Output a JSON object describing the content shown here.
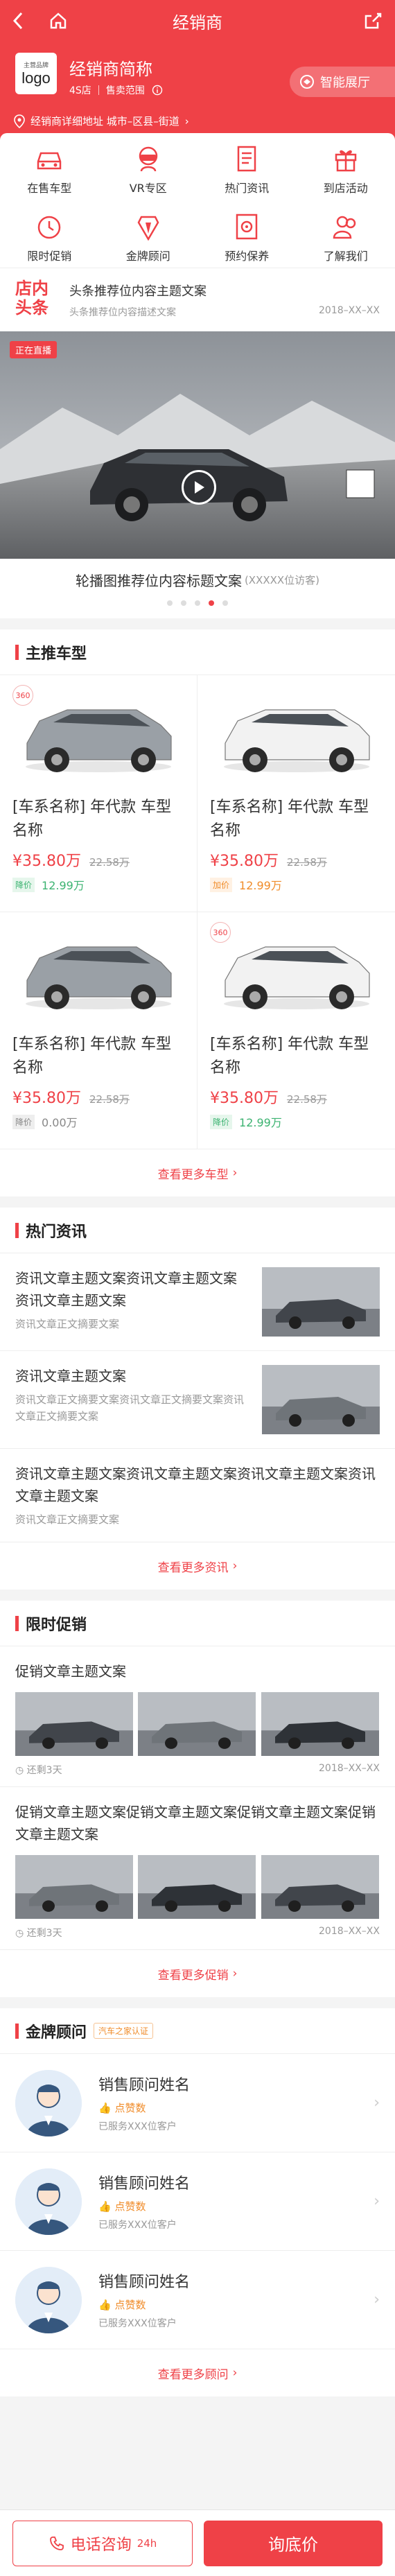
{
  "topbar": {
    "title": "经销商"
  },
  "header": {
    "logo_top": "主营品牌",
    "logo_bottom": "logo",
    "dealer_name": "经销商简称",
    "store_type": "4S店",
    "sales_scope": "售卖范围",
    "showroom_label": "智能展厅",
    "address": "经销商详细地址 城市–区县–街道"
  },
  "features": [
    {
      "label": "在售车型",
      "icon": "car-icon"
    },
    {
      "label": "VR专区",
      "icon": "vr-icon"
    },
    {
      "label": "热门资讯",
      "icon": "news-icon"
    },
    {
      "label": "到店活动",
      "icon": "gift-icon"
    },
    {
      "label": "限时促销",
      "icon": "clock-icon"
    },
    {
      "label": "金牌顾问",
      "icon": "advisor-icon"
    },
    {
      "label": "预约保养",
      "icon": "maintenance-icon"
    },
    {
      "label": "了解我们",
      "icon": "people-icon"
    }
  ],
  "headline": {
    "logo_line1": "店内",
    "logo_line2": "头条",
    "title": "头条推荐位内容主题文案",
    "desc": "头条推荐位内容描述文案",
    "date": "2018–XX–XX"
  },
  "banner": {
    "live_tag": "正在直播",
    "caption": "轮播图推荐位内容标题文案",
    "visitors": "(XXXXX位访客)",
    "active_dot": 3,
    "dot_count": 5
  },
  "main_models": {
    "title": "主推车型",
    "more": "查看更多车型",
    "cars": [
      {
        "name": "[车系名称] 年代款 车型名称",
        "price": "¥35.80万",
        "old_price": "22.58万",
        "diff_label": "降价",
        "diff_value": "12.99万",
        "badge": "360",
        "diff_type": "down"
      },
      {
        "name": "[车系名称] 年代款 车型名称",
        "price": "¥35.80万",
        "old_price": "22.58万",
        "diff_label": "加价",
        "diff_value": "12.99万",
        "badge": "",
        "diff_type": "up"
      },
      {
        "name": "[车系名称] 年代款 车型名称",
        "price": "¥35.80万",
        "old_price": "22.58万",
        "diff_label": "降价",
        "diff_value": "0.00万",
        "badge": "",
        "diff_type": "zero"
      },
      {
        "name": "[车系名称] 年代款 车型名称",
        "price": "¥35.80万",
        "old_price": "22.58万",
        "diff_label": "降价",
        "diff_value": "12.99万",
        "badge": "360",
        "diff_type": "down"
      }
    ]
  },
  "news": {
    "title": "热门资讯",
    "more": "查看更多资讯",
    "items": [
      {
        "title": "资讯文章主题文案资讯文章主题文案资讯文章主题文案",
        "summary": "资讯文章正文摘要文案",
        "has_image": true
      },
      {
        "title": "资讯文章主题文案",
        "summary": "资讯文章正文摘要文案资讯文章正文摘要文案资讯文章正文摘要文案",
        "has_image": true
      },
      {
        "title": "资讯文章主题文案资讯文章主题文案资讯文章主题文案资讯文章主题文案",
        "summary": "资讯文章正文摘要文案",
        "has_image": false
      }
    ]
  },
  "promo": {
    "title": "限时促销",
    "more": "查看更多促销",
    "items": [
      {
        "title": "促销文章主题文案",
        "remaining": "还剩3天",
        "date": "2018–XX–XX"
      },
      {
        "title": "促销文章主题文案促销文章主题文案促销文章主题文案促销文章主题文案",
        "remaining": "还剩3天",
        "date": "2018–XX–XX"
      }
    ]
  },
  "advisors": {
    "title": "金牌顾问",
    "tag": "汽车之家认证",
    "more": "查看更多顾问",
    "items": [
      {
        "name": "销售顾问姓名",
        "likes": "点赞数",
        "served": "已服务XXX位客户"
      },
      {
        "name": "销售顾问姓名",
        "likes": "点赞数",
        "served": "已服务XXX位客户"
      },
      {
        "name": "销售顾问姓名",
        "likes": "点赞数",
        "served": "已服务XXX位客户"
      }
    ]
  },
  "bottom": {
    "phone_label": "电话咨询",
    "phone_hours": "24h",
    "quote_label": "询底价"
  },
  "colors": {
    "accent": "#ef4147",
    "orange": "#f08c2a",
    "green": "#3cb371"
  }
}
